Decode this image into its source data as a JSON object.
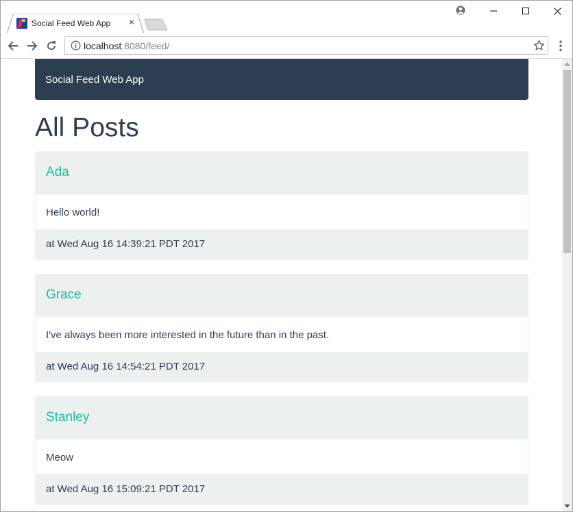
{
  "browser": {
    "tab": {
      "title": "Social Feed Web App",
      "close_glyph": "×",
      "favicon": "app-favicon-icon"
    },
    "address_bar": {
      "host": "localhost",
      "path": ":8080/feed/"
    },
    "icons": [
      "back-arrow-icon",
      "forward-arrow-icon",
      "reload-icon",
      "info-icon",
      "star-icon",
      "menu-kebab-icon",
      "profile-icon",
      "minimize-icon",
      "maximize-icon",
      "close-icon"
    ]
  },
  "navbar": {
    "brand": "Social Feed Web App",
    "background": "#2c3e50"
  },
  "page": {
    "title": "All Posts"
  },
  "theme": {
    "accent": "#18bc9c",
    "panel_bg": "#ecf0f1",
    "text": "#2c3e50"
  },
  "posts": [
    {
      "author": "Ada",
      "text": "Hello world!",
      "time": "at Wed Aug 16 14:39:21 PDT 2017"
    },
    {
      "author": "Grace",
      "text": "I've always been more interested in the future than in the past.",
      "time": "at Wed Aug 16 14:54:21 PDT 2017"
    },
    {
      "author": "Stanley",
      "text": "Meow",
      "time": "at Wed Aug 16 15:09:21 PDT 2017"
    }
  ]
}
